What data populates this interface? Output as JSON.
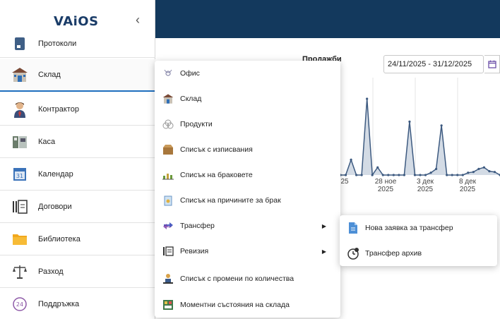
{
  "app": {
    "logo": "VAiOS",
    "collapse_glyph": "‹"
  },
  "sidebar": {
    "items": [
      {
        "label": "Протоколи",
        "icon": "protocol-icon"
      },
      {
        "label": "Склад",
        "icon": "warehouse-icon",
        "active": true
      },
      {
        "label": "Контрактор",
        "icon": "contractor-icon"
      },
      {
        "label": "Каса",
        "icon": "cash-register-icon"
      },
      {
        "label": "Календар",
        "icon": "calendar-icon",
        "badge": "31"
      },
      {
        "label": "Договори",
        "icon": "contracts-icon"
      },
      {
        "label": "Библиотека",
        "icon": "folder-icon"
      },
      {
        "label": "Разход",
        "icon": "scales-icon"
      },
      {
        "label": "Поддръжка",
        "icon": "support-24-icon",
        "badge": "24"
      }
    ]
  },
  "main": {
    "sales_title": "Продажби",
    "date_range": "24/11/2025 - 31/12/2025"
  },
  "chart_data": {
    "type": "area",
    "x_tick_labels": [
      "",
      "28 ное\n2025",
      "3 дек\n2025",
      "8 дек\n2025"
    ],
    "x_tick_label_first_partial": "25",
    "values": [
      0,
      0,
      2,
      0,
      0,
      10,
      0,
      1,
      0,
      0,
      0,
      0,
      0,
      7,
      0,
      0,
      0,
      0.3,
      0.8,
      6.5,
      0,
      0,
      0,
      0,
      0.3,
      0.4,
      0.8,
      1,
      0.5,
      0.4,
      0
    ],
    "color": "#3d5a80",
    "fill": "#d3dbe5"
  },
  "context_menu": {
    "items": [
      {
        "label": "Офис",
        "icon": "office-icon"
      },
      {
        "label": "Склад",
        "icon": "warehouse-icon"
      },
      {
        "label": "Продукти",
        "icon": "products-icon"
      },
      {
        "label": "Списък с изписвания",
        "icon": "box-icon"
      },
      {
        "label": "Списък на браковете",
        "icon": "defects-icon"
      },
      {
        "label": "Списък на причините за брак",
        "icon": "reasons-icon"
      },
      {
        "label": "Трансфер",
        "icon": "transfer-icon",
        "submenu": true
      },
      {
        "label": "Ревизия",
        "icon": "revision-icon",
        "submenu": true
      },
      {
        "label": "Списък с промени по количества",
        "icon": "quantity-changes-icon"
      },
      {
        "label": "Моментни състояния на склада",
        "icon": "warehouse-state-icon"
      }
    ],
    "submenu_arrow": "▶"
  },
  "submenu": {
    "items": [
      {
        "label": "Нова заявка за трансфер",
        "icon": "new-request-icon"
      },
      {
        "label": "Трансфер архив",
        "icon": "archive-icon"
      }
    ]
  }
}
